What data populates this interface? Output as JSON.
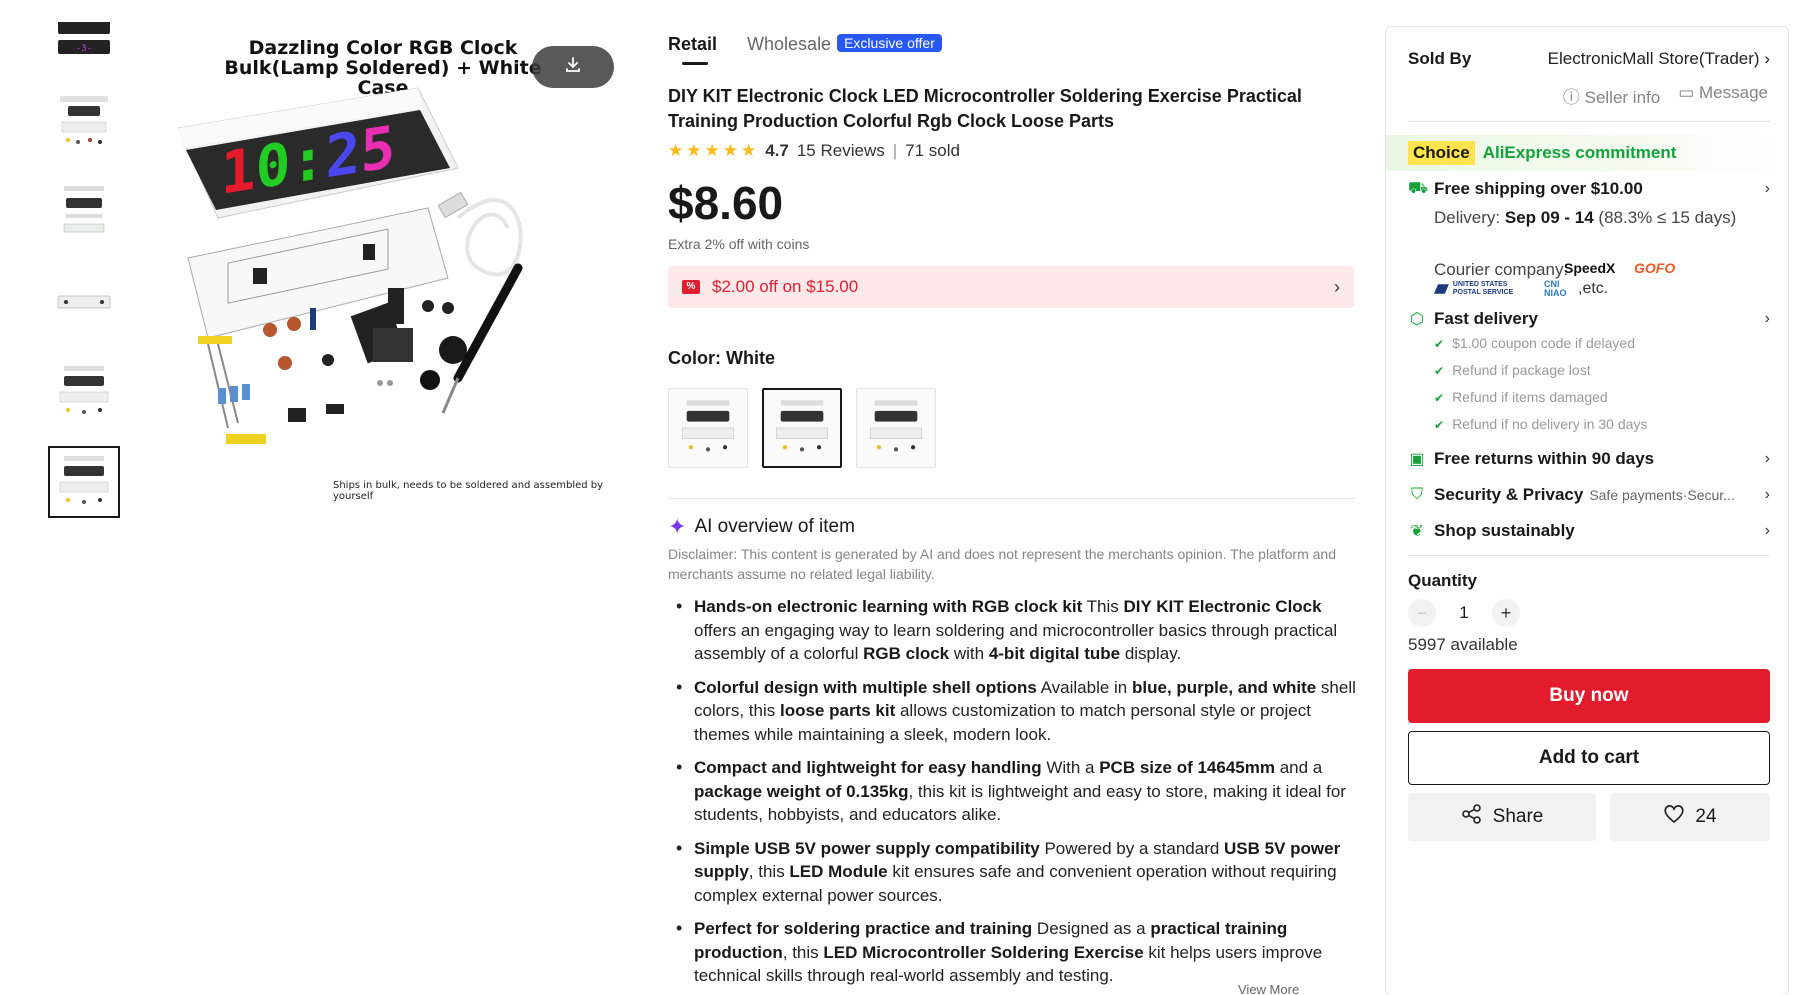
{
  "colors": {
    "accent_red": "#e21c2d",
    "green": "#14a33b",
    "blue_badge": "#2758f6",
    "star": "#fdb914"
  },
  "gallery": {
    "thumbnails": [
      "thumb-1",
      "thumb-2",
      "thumb-3",
      "thumb-4",
      "thumb-5",
      "thumb-6"
    ],
    "selected_index": 5,
    "image_title": "Dazzling Color RGB Clock Bulk(Lamp Soldered) + White Case",
    "clock_digits": [
      "1",
      "0",
      ":",
      "2",
      "5"
    ],
    "image_caption": "Ships in bulk, needs to be soldered and assembled by yourself",
    "download_icon": "download-icon"
  },
  "tabs": {
    "retail": "Retail",
    "wholesale": "Wholesale",
    "badge": "Exclusive offer"
  },
  "product": {
    "title": "DIY KIT Electronic Clock LED Microcontroller Soldering Exercise Practical Training Production Colorful Rgb Clock Loose Parts",
    "stars": "★★★★★",
    "rating": "4.7",
    "reviews": "15 Reviews",
    "sold": "71 sold",
    "price": "$8.60",
    "coins_note": "Extra 2% off with coins",
    "coupon": "$2.00 off on $15.00",
    "coupon_tag": "%",
    "color_label": "Color: White",
    "swatches": [
      "swatch-1",
      "swatch-2",
      "swatch-3"
    ],
    "selected_swatch": 1
  },
  "ai": {
    "heading": "AI overview of item",
    "disclaimer": "Disclaimer: This content is generated by AI and does not represent the merchants opinion. The platform and merchants assume no related legal liability.",
    "bullets": [
      {
        "head": "Hands-on electronic learning with RGB clock kit",
        "t1": " This ",
        "b1": "DIY KIT Electronic Clock",
        "t2": " offers an engaging way to learn soldering and microcontroller basics through practical assembly of a colorful ",
        "b2": "RGB clock",
        "t3": " with ",
        "b3": "4-bit digital tube",
        "t4": " display."
      },
      {
        "head": "Colorful design with multiple shell options",
        "t1": " Available in ",
        "b1": "blue, purple, and white",
        "t2": " shell colors, this ",
        "b2": "loose parts kit",
        "t3": " allows customization to match personal style or project themes while maintaining a sleek, modern look.",
        "b3": "",
        "t4": ""
      },
      {
        "head": "Compact and lightweight for easy handling",
        "t1": " With a ",
        "b1": "PCB size of 14645mm",
        "t2": " and a ",
        "b2": "package weight of 0.135kg",
        "t3": ", this kit is lightweight and easy to store, making it ideal for students, hobbyists, and educators alike.",
        "b3": "",
        "t4": ""
      },
      {
        "head": "Simple USB 5V power supply compatibility",
        "t1": " Powered by a standard ",
        "b1": "USB 5V power supply",
        "t2": ", this ",
        "b2": "LED Module",
        "t3": " kit ensures safe and convenient operation without requiring complex external power sources.",
        "b3": "",
        "t4": ""
      },
      {
        "head": "Perfect for soldering practice and training",
        "t1": " Designed as a ",
        "b1": "practical training production",
        "t2": ", this ",
        "b2": "LED Microcontroller Soldering Exercise",
        "t3": " kit helps users improve technical skills through real-world assembly and testing.",
        "b3": "",
        "t4": ""
      }
    ],
    "view_more": "View More"
  },
  "seller": {
    "sold_by_label": "Sold By",
    "store": "ElectronicMall Store(Trader)",
    "seller_info": "Seller info",
    "message": "Message"
  },
  "commitment": {
    "choice": "Choice",
    "label": "AliExpress commitment",
    "free_shipping": "Free shipping over $10.00",
    "delivery_label": "Delivery: ",
    "delivery_dates": "Sep 09 - 14",
    "delivery_note": " (88.3% ≤ 15 days)",
    "courier_label": "Courier company: ",
    "couriers": [
      "SpeedX",
      "GOFO",
      "UNITED STATES POSTAL SERVICE",
      "CNI NIAO",
      ",etc."
    ],
    "fast_delivery": "Fast delivery",
    "fast_items": [
      "$1.00 coupon code if delayed",
      "Refund if package lost",
      "Refund if items damaged",
      "Refund if no delivery in 30 days"
    ],
    "free_returns": "Free returns within 90 days",
    "security": "Security & Privacy",
    "security_note": "Safe payments·Secur...",
    "sustain": "Shop sustainably"
  },
  "purchase": {
    "qty_label": "Quantity",
    "qty": "1",
    "available": "5997 available",
    "buy_now": "Buy now",
    "add_to_cart": "Add to cart",
    "share": "Share",
    "wishlist_count": "24"
  }
}
